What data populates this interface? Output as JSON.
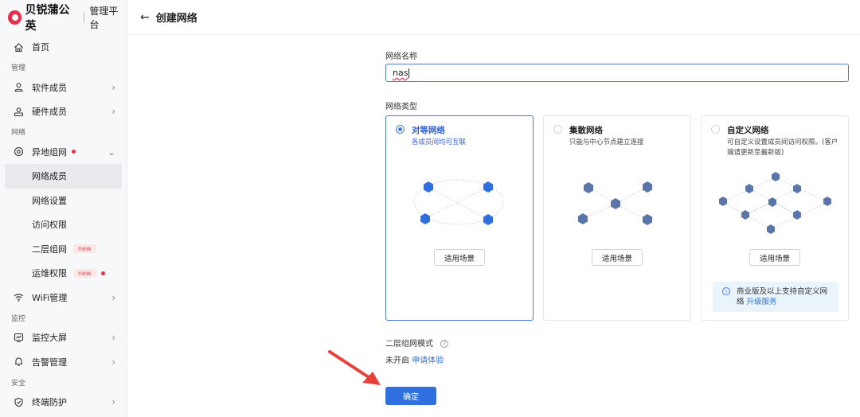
{
  "brand": {
    "name": "贝锐蒲公英",
    "subtitle": "管理平台",
    "logo_color": "#e8304a"
  },
  "header": {
    "title": "创建网络",
    "back_icon": "arrow-left-icon"
  },
  "sidebar": {
    "home": "首页",
    "section_manage": "管理",
    "software_members": "软件成员",
    "hardware_members": "硬件成员",
    "section_network": "网络",
    "remote_network": "异地组网",
    "network_members": "网络成员",
    "network_settings": "网络设置",
    "access_control": "访问权限",
    "layer2": "二层组网",
    "ops_permissions": "运维权限",
    "new_badge": "new",
    "wifi": "WiFi管理",
    "section_monitor": "监控",
    "dashboard": "监控大屏",
    "alerts": "告警管理",
    "section_security": "安全",
    "endpoint": "终端防护"
  },
  "form": {
    "name_label": "网络名称",
    "name_value": "nas",
    "type_label": "网络类型",
    "cards": [
      {
        "title": "对等网络",
        "desc": "各成员间均可互联",
        "button": "适用场景",
        "selected": true
      },
      {
        "title": "集散网络",
        "desc": "只能与中心节点建立连接",
        "button": "适用场景",
        "selected": false
      },
      {
        "title": "自定义网络",
        "desc": "可自定义设置成员间访问权限。(客户端请更新至最新版)",
        "button": "适用场景",
        "selected": false
      }
    ],
    "tip_text": "商业版及以上支持自定义网络",
    "tip_link": "升级服务",
    "layer2_label": "二层组网模式",
    "layer2_status": "未开启",
    "layer2_link": "申请体验",
    "confirm": "确定"
  },
  "colors": {
    "accent": "#2f6fde",
    "selected_border": "#4b77e6",
    "annotation_arrow": "#e8403a"
  }
}
